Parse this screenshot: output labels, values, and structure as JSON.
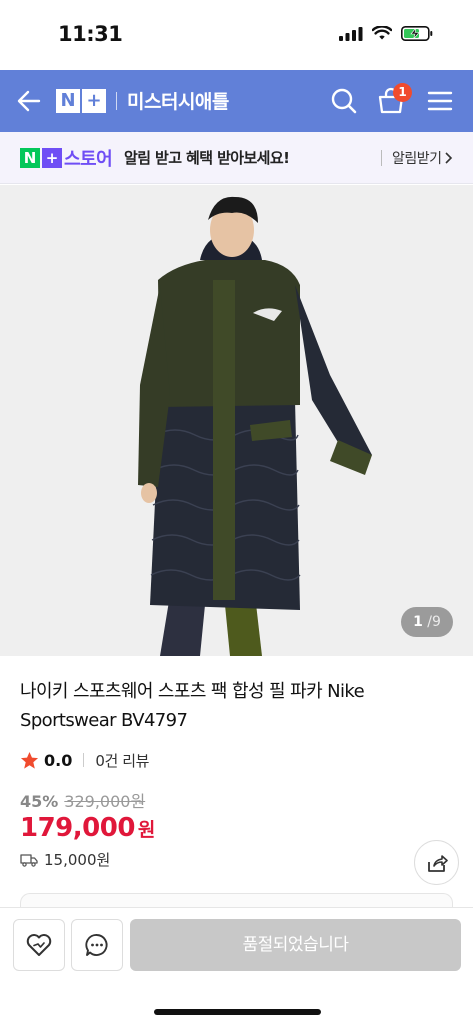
{
  "status_bar": {
    "time": "11:31"
  },
  "header": {
    "logo_n": "N",
    "logo_plus": "+",
    "store_name": "미스터시애틀",
    "cart_count": "1"
  },
  "promo": {
    "logo_n": "N",
    "logo_plus": "+",
    "store_label": "스토어",
    "message": "알림 받고 혜택 받아보세요!",
    "action_label": "알림받기"
  },
  "gallery": {
    "current_page": "1",
    "separator": "/",
    "total_pages": "9"
  },
  "product": {
    "title": "나이키 스포츠웨어 스포츠 팩 합성 필 파카 Nike Sportswear BV4797",
    "rating": "0.0",
    "review_count": "0건 리뷰",
    "discount_rate": "45%",
    "original_price": "329,000원",
    "sale_price": "179,000",
    "sale_unit": "원",
    "shipping_fee": "15,000원"
  },
  "bottom_bar": {
    "cta_label": "품절되었습니다"
  },
  "colors": {
    "header_bg": "#6180d8",
    "promo_purple": "#6f4ef5",
    "naver_green": "#03c75a",
    "sale_red": "#e0173a",
    "badge_red": "#f04b2e",
    "star": "#f04b2e",
    "soldout_gray": "#c8c8c8"
  }
}
